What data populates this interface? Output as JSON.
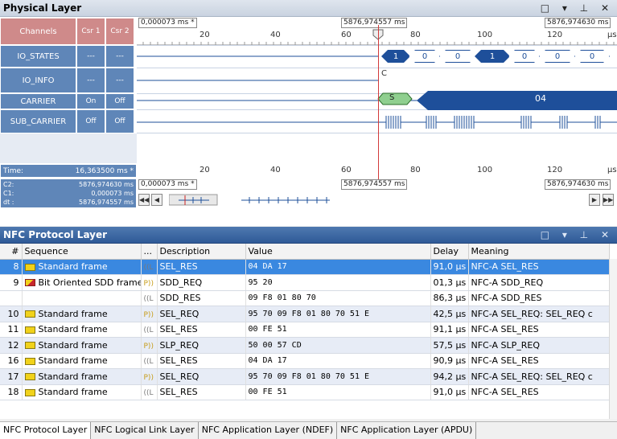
{
  "physical": {
    "title": "Physical Layer",
    "window_buttons": "□ ▾ ⊥ ✕",
    "header": {
      "channels": "Channels",
      "csr1": "Csr 1",
      "csr2": "Csr 2"
    },
    "ruler_top": {
      "left_ts": "0,000073 ms *",
      "center_ts": "5876,974557 ms",
      "right_ts": "5876,974630 ms",
      "ticks": [
        "20",
        "40",
        "60",
        "80",
        "100",
        "120"
      ],
      "unit": "µs"
    },
    "channels": [
      {
        "name": "IO_STATES",
        "c1": "---",
        "c2": "---"
      },
      {
        "name": "IO_INFO",
        "c1": "---",
        "c2": "---"
      },
      {
        "name": "CARRIER",
        "c1": "On",
        "c2": "Off"
      },
      {
        "name": "SUB_CARRIER",
        "c1": "Off",
        "c2": "Off"
      }
    ],
    "io_states_values": [
      "1",
      "0",
      "0",
      "1",
      "0",
      "0",
      "0"
    ],
    "io_info": {
      "s_label": "S",
      "c_label": "C",
      "value": "04"
    },
    "time_row": {
      "label": "Time:",
      "value": "16,363500 ms *",
      "ticks": [
        "20",
        "40",
        "60",
        "80",
        "100",
        "120"
      ],
      "unit": "µs"
    },
    "cursor_info": {
      "c2_label": "C2:",
      "c2_val": "5876,974630 ms",
      "c1_label": "C1:",
      "c1_val": "0,000073 ms",
      "dt_label": "dt :",
      "dt_val": "5876,974557 ms"
    },
    "ruler_bottom": {
      "left_ts": "0,000073 ms *",
      "center_ts": "5876,974557 ms",
      "right_ts": "5876,974630 ms"
    }
  },
  "protocol": {
    "title": "NFC Protocol Layer",
    "window_buttons": "□ ▾ ⊥ ✕",
    "columns": [
      "#",
      "Sequence",
      "...",
      "Description",
      "Value",
      "Delay",
      "Meaning"
    ],
    "rows": [
      {
        "num": "8",
        "seq": "Standard frame",
        "icon": "standard",
        "dir": "L",
        "desc": "SEL_RES",
        "value": "04 DA 17",
        "delay": "91,0 µs",
        "meaning": "NFC-A SEL_RES",
        "state": "sel"
      },
      {
        "num": "9",
        "seq": "Bit Oriented SDD frame",
        "icon": "bit",
        "dir": "P",
        "desc": "SDD_REQ",
        "value": "95 20",
        "delay": "01,3 µs",
        "meaning": "NFC-A SDD_REQ",
        "state": ""
      },
      {
        "num": "",
        "seq": "",
        "icon": "",
        "dir": "L",
        "desc": "SDD_RES",
        "value": "09 F8 01 80 70",
        "delay": "86,3 µs",
        "meaning": "NFC-A SDD_RES",
        "state": ""
      },
      {
        "num": "10",
        "seq": "Standard frame",
        "icon": "standard",
        "dir": "P",
        "desc": "SEL_REQ",
        "value": "95 70 09 F8 01 80 70 51 E",
        "delay": "42,5 µs",
        "meaning": "NFC-A SEL_REQ: SEL_REQ c",
        "state": "alt"
      },
      {
        "num": "11",
        "seq": "Standard frame",
        "icon": "standard",
        "dir": "L",
        "desc": "SEL_RES",
        "value": "00 FE 51",
        "delay": "91,1 µs",
        "meaning": "NFC-A SEL_RES",
        "state": ""
      },
      {
        "num": "12",
        "seq": "Standard frame",
        "icon": "standard",
        "dir": "P",
        "desc": "SLP_REQ",
        "value": "50 00 57 CD",
        "delay": "57,5 µs",
        "meaning": "NFC-A SLP_REQ",
        "state": "alt"
      },
      {
        "num": "16",
        "seq": "Standard frame",
        "icon": "standard",
        "dir": "L",
        "desc": "SEL_RES",
        "value": "04 DA 17",
        "delay": "90,9 µs",
        "meaning": "NFC-A SEL_RES",
        "state": ""
      },
      {
        "num": "17",
        "seq": "Standard frame",
        "icon": "standard",
        "dir": "P",
        "desc": "SEL_REQ",
        "value": "95 70 09 F8 01 80 70 51 E",
        "delay": "94,2 µs",
        "meaning": "NFC-A SEL_REQ: SEL_REQ c",
        "state": "alt"
      },
      {
        "num": "18",
        "seq": "Standard frame",
        "icon": "standard",
        "dir": "L",
        "desc": "SEL_RES",
        "value": "00 FE 51",
        "delay": "91,0 µs",
        "meaning": "NFC-A SEL_RES",
        "state": ""
      }
    ]
  },
  "tabs": [
    "NFC Protocol Layer",
    "NFC Logical Link Layer",
    "NFC Application Layer (NDEF)",
    "NFC Application Layer (APDU)"
  ]
}
